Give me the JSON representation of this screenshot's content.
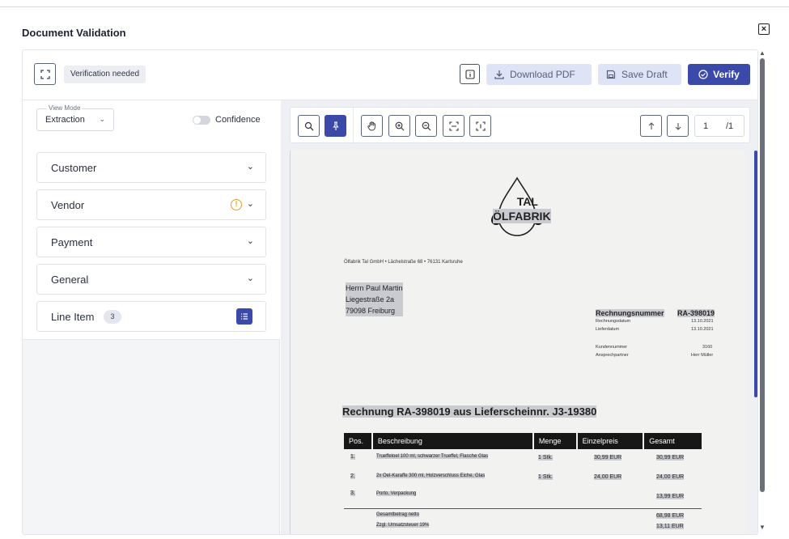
{
  "dialog": {
    "title": "Document Validation",
    "close_label": "×"
  },
  "toolbar": {
    "status_badge": "Verification needed",
    "download_label": "Download PDF",
    "save_draft_label": "Save Draft",
    "verify_label": "Verify"
  },
  "sidebar": {
    "view_mode_label": "View Mode",
    "view_mode_value": "Extraction",
    "confidence_label": "Confidence",
    "sections": [
      {
        "label": "Customer"
      },
      {
        "label": "Vendor"
      },
      {
        "label": "Payment"
      },
      {
        "label": "General"
      },
      {
        "label": "Line Item",
        "count": "3"
      }
    ]
  },
  "viewer": {
    "page_current": "1",
    "page_total": "/1"
  },
  "document": {
    "logo_line1": "TAL",
    "logo_line2": "ÖLFABRIK",
    "sender_line": "Ölfabrik Tal GmbH • Lächelstraße 68 • 76131 Karlsruhe",
    "recipient": [
      "Herrn Paul Martin",
      "Liegestraße 2a",
      "79098 Freiburg"
    ],
    "invoice_number_label": "Rechnungsnummer",
    "invoice_number": "RA-398019",
    "meta": [
      {
        "label": "Rechnungsdatum",
        "value": "13.10.2021"
      },
      {
        "label": "Lieferdatum",
        "value": "13.10.2021"
      },
      {
        "label": "Kundennummer",
        "value": "3160"
      },
      {
        "label": "Ansprechpartner",
        "value": "Herr Müller"
      }
    ],
    "title": "Rechnung RA-398019 aus Lieferscheinnr. J3-19380",
    "table_headers": [
      "Pos.",
      "Beschreibung",
      "Menge",
      "Einzelpreis",
      "Gesamt"
    ],
    "rows": [
      {
        "pos": "1.",
        "desc": "Trueffeloel 100 ml, schwarzer Trueffel, Flasche Glas",
        "qty": "1 Stk.",
        "unit": "30,99 EUR",
        "total": "30,99 EUR"
      },
      {
        "pos": "2.",
        "desc": "2x Oel-Karaffe 300 ml, Holzverschluss Eiche, Glas",
        "qty": "1 Stk.",
        "unit": "24,00 EUR",
        "total": "24,00 EUR"
      },
      {
        "pos": "3.",
        "desc": "Porto, Verpackung",
        "qty": "",
        "unit": "",
        "total": "13,99 EUR"
      }
    ],
    "net_label": "Gesamtbetrag netto",
    "net_value": "68,98 EUR",
    "vat_label": "Zzgl. Umsatzsteuer 19%",
    "vat_value": "13,11 EUR"
  }
}
